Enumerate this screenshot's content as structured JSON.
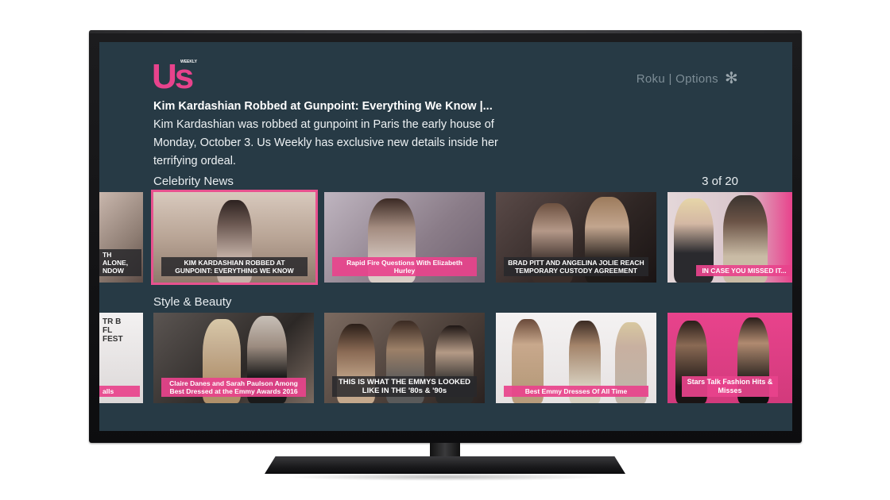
{
  "header": {
    "logo_text": "Us",
    "logo_subtext": "WEEKLY",
    "options_label": "Roku | Options",
    "options_icon": "asterisk-icon"
  },
  "featured": {
    "title": "Kim Kardashian Robbed at Gunpoint: Everything We Know |...",
    "description": "Kim Kardashian was robbed at gunpoint in Paris the early house of Monday, October 3. Us Weekly has exclusive new details inside her terrifying ordeal."
  },
  "rows": [
    {
      "title": "Celebrity News",
      "count": "3 of 20",
      "tiles": [
        {
          "caption": "TH ALONE, NDOW"
        },
        {
          "caption": "KIM KARDASHIAN ROBBED AT GUNPOINT: EVERYTHING WE KNOW"
        },
        {
          "caption": "Rapid Fire Questions With Elizabeth Hurley"
        },
        {
          "caption": "BRAD PITT AND ANGELINA JOLIE REACH TEMPORARY CUSTODY AGREEMENT"
        },
        {
          "caption": "IN CASE YOU MISSED IT..."
        }
      ]
    },
    {
      "title": "Style & Beauty",
      "tiles": [
        {
          "caption": "alls"
        },
        {
          "caption": "Claire Danes and Sarah Paulson Among Best Dressed at the Emmy Awards 2016"
        },
        {
          "caption": "THIS IS WHAT THE EMMYS LOOKED LIKE IN THE '80s & '90s"
        },
        {
          "caption": "Best Emmy Dresses Of All Time"
        },
        {
          "caption": "Stars Talk Fashion Hits & Misses"
        }
      ]
    }
  ],
  "colors": {
    "background": "#273a45",
    "accent": "#e8438c",
    "muted_text": "#7d8d96"
  }
}
